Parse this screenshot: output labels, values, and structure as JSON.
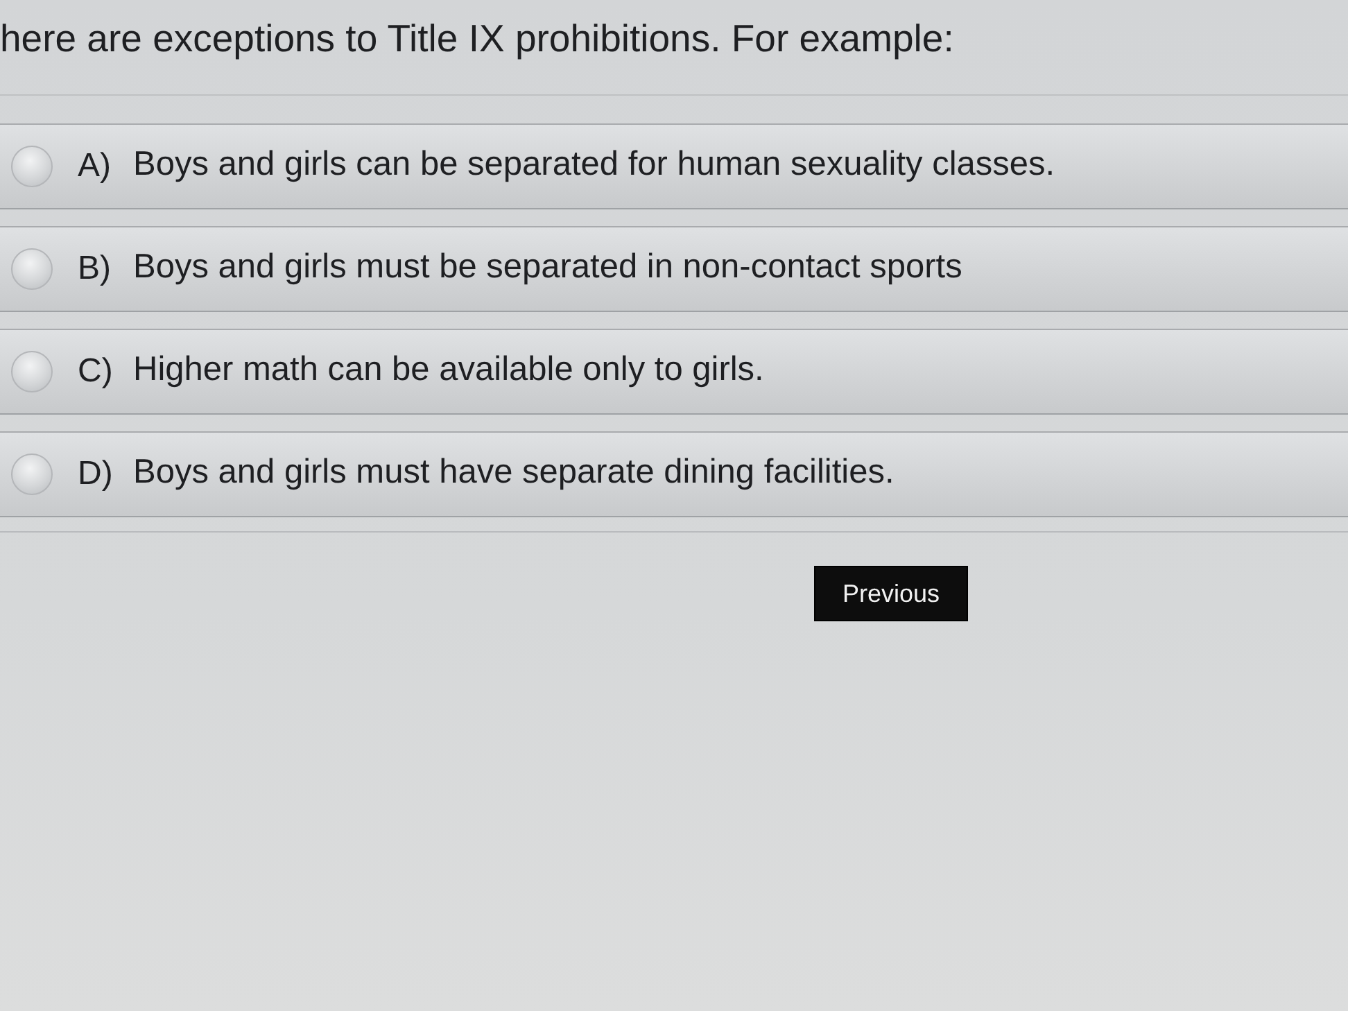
{
  "question": {
    "text": "here are exceptions to Title IX prohibitions. For example:"
  },
  "options": [
    {
      "letter": "A)",
      "text": "Boys and girls can be separated for human sexuality classes.",
      "selected": false
    },
    {
      "letter": "B)",
      "text": "Boys and girls must be separated in non-contact sports",
      "selected": false
    },
    {
      "letter": "C)",
      "text": "Higher math can be available only to girls.",
      "selected": false
    },
    {
      "letter": "D)",
      "text": "Boys and girls must have separate dining facilities.",
      "selected": false
    }
  ],
  "buttons": [
    {
      "label": "Previous"
    }
  ]
}
